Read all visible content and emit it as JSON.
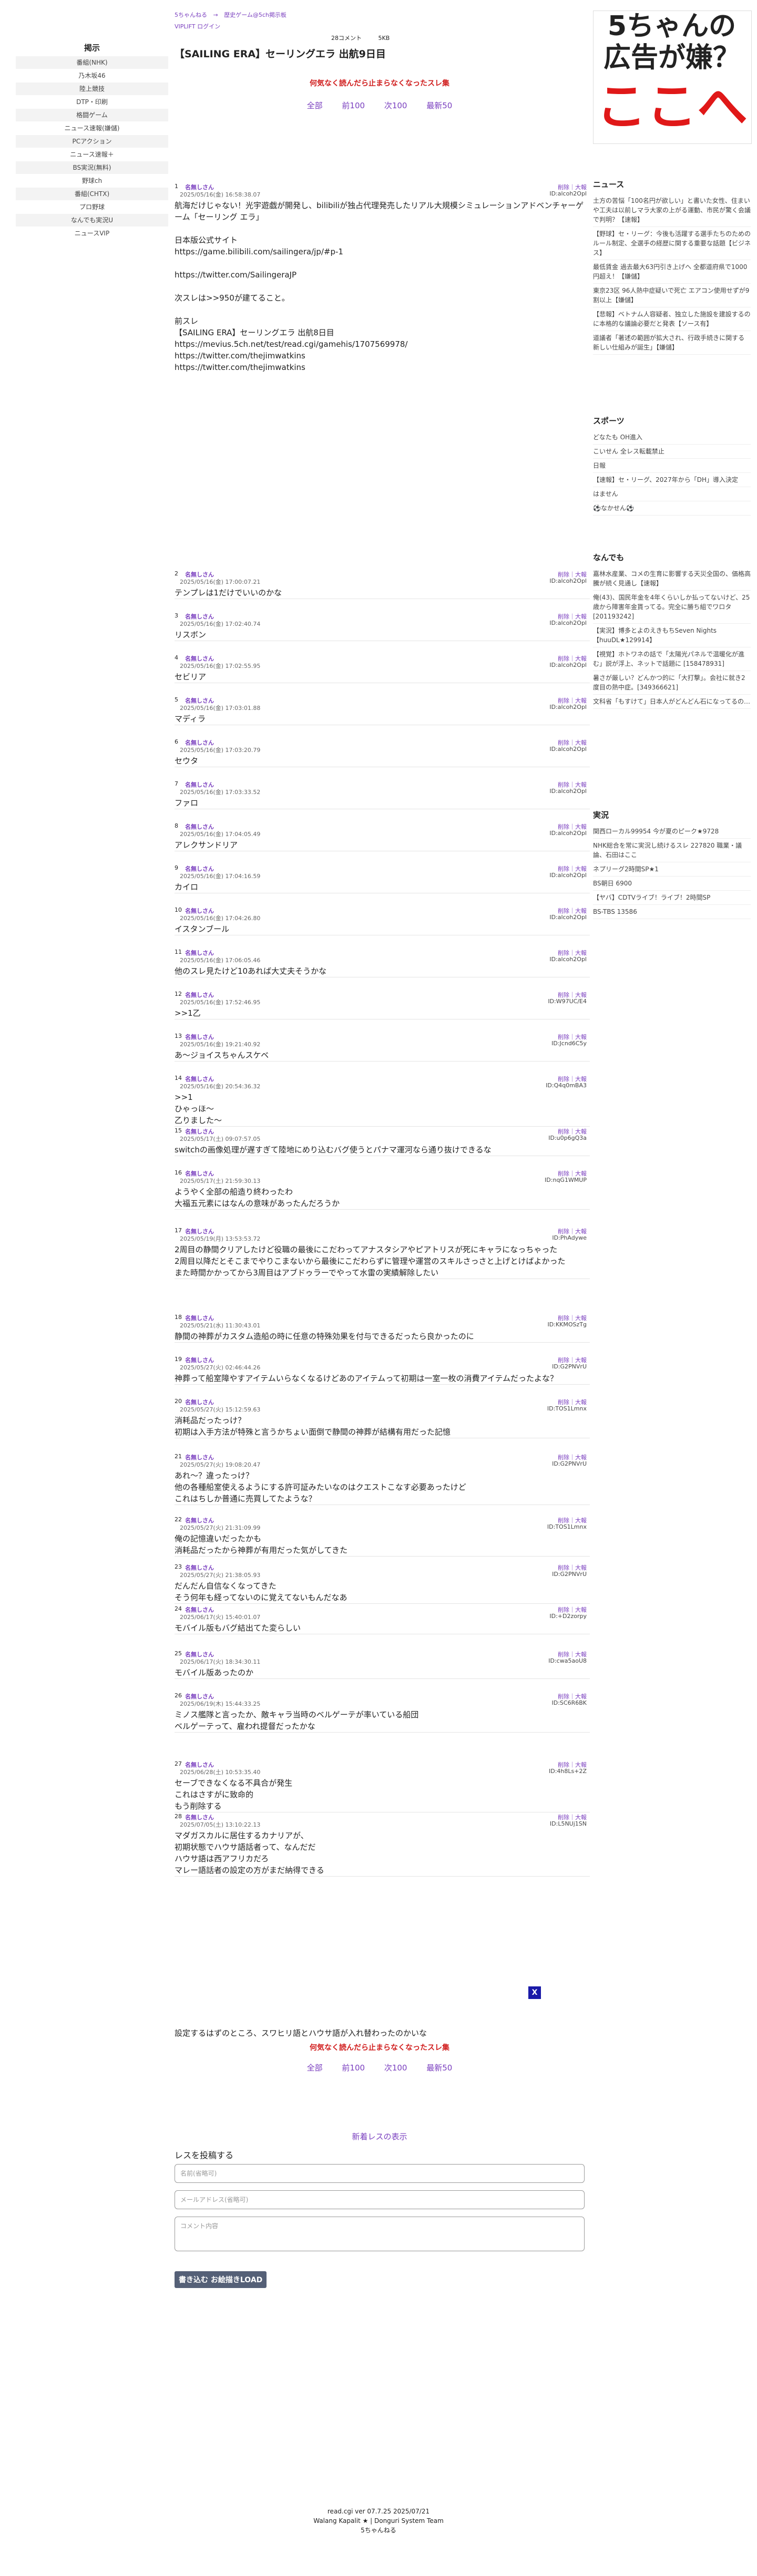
{
  "breadcrumb": [
    "5ちゃんねる",
    "→",
    "歴史ゲーム@5ch掲示板"
  ],
  "login": "VIPLIFT ログイン",
  "meta": {
    "comments": "28コメント",
    "size": "5KB"
  },
  "title": "【SAILING ERA】セーリングエラ 出航9日目",
  "hot_link": "何気なく読んだら止まらなくなったスレ集",
  "pager": [
    "全部",
    "前100",
    "次100",
    "最新50"
  ],
  "sidebar": {
    "heading": "掲示",
    "items": [
      "番組(NHK)",
      "乃木坂46",
      "陸上競技",
      "DTP・印刷",
      "格闘ゲーム",
      "ニュース速報(嫌儲)",
      "PCアクション",
      "ニュース速報＋",
      "BS実況(無料)",
      "野球ch",
      "番組(CHTX)",
      "プロ野球",
      "なんでも実況U",
      "ニュースVIP"
    ]
  },
  "posts": [
    {
      "num": "1",
      "name": "名無しさん",
      "date": "2025/05/16(金) 16:58:38.07",
      "ctrl": "削除｜大報",
      "id": "ID:alcoh2Opl",
      "body": "航海だけじゃない！光宇遊戯が開発し、bilibiliが独占代理発売したリアル大規模シミュレーションアドベンチャーゲーム「セーリング エラ」\n\n日本版公式サイト\nhttps://game.bilibili.com/sailingera/jp/#p-1\n\nhttps://twitter.com/SailingeraJP\n\n次スレは>>950が建てること。\n\n前スレ\n【SAILING ERA】セーリングエラ 出航8日目\nhttps://mevius.5ch.net/test/read.cgi/gamehis/1707569978/\nhttps://twitter.com/thejimwatkins\nhttps://twitter.com/thejimwatkins"
    },
    {
      "num": "2",
      "name": "名無しさん",
      "date": "2025/05/16(金) 17:00:07.21",
      "ctrl": "削除｜大報",
      "id": "ID:alcoh2Opl",
      "body": "テンプレは1だけでいいのかな"
    },
    {
      "num": "3",
      "name": "名無しさん",
      "date": "2025/05/16(金) 17:02:40.74",
      "ctrl": "削除｜大報",
      "id": "ID:alcoh2Opl",
      "body": "リスボン"
    },
    {
      "num": "4",
      "name": "名無しさん",
      "date": "2025/05/16(金) 17:02:55.95",
      "ctrl": "削除｜大報",
      "id": "ID:alcoh2Opl",
      "body": "セビリア"
    },
    {
      "num": "5",
      "name": "名無しさん",
      "date": "2025/05/16(金) 17:03:01.88",
      "ctrl": "削除｜大報",
      "id": "ID:alcoh2Opl",
      "body": "マディラ"
    },
    {
      "num": "6",
      "name": "名無しさん",
      "date": "2025/05/16(金) 17:03:20.79",
      "ctrl": "削除｜大報",
      "id": "ID:alcoh2Opl",
      "body": "セウタ"
    },
    {
      "num": "7",
      "name": "名無しさん",
      "date": "2025/05/16(金) 17:03:33.52",
      "ctrl": "削除｜大報",
      "id": "ID:alcoh2Opl",
      "body": "ファロ"
    },
    {
      "num": "8",
      "name": "名無しさん",
      "date": "2025/05/16(金) 17:04:05.49",
      "ctrl": "削除｜大報",
      "id": "ID:alcoh2Opl",
      "body": "アレクサンドリア"
    },
    {
      "num": "9",
      "name": "名無しさん",
      "date": "2025/05/16(金) 17:04:16.59",
      "ctrl": "削除｜大報",
      "id": "ID:alcoh2Opl",
      "body": "カイロ"
    },
    {
      "num": "10",
      "name": "名無しさん",
      "date": "2025/05/16(金) 17:04:26.80",
      "ctrl": "削除｜大報",
      "id": "ID:alcoh2Opl",
      "body": "イスタンブール"
    },
    {
      "num": "11",
      "name": "名無しさん",
      "date": "2025/05/16(金) 17:06:05.46",
      "ctrl": "削除｜大報",
      "id": "ID:alcoh2Opl",
      "body": "他のスレ見たけど10あれば大丈夫そうかな"
    },
    {
      "num": "12",
      "name": "名無しさん",
      "date": "2025/05/16(金) 17:52:46.95",
      "ctrl": "削除｜大報",
      "id": "ID:W97UC/E4",
      "body": ">>1乙"
    },
    {
      "num": "13",
      "name": "名無しさん",
      "date": "2025/05/16(金) 19:21:40.92",
      "ctrl": "削除｜大報",
      "id": "ID:Jcnd6C5y",
      "body": "あ〜ジョイスちゃんスケベ"
    },
    {
      "num": "14",
      "name": "名無しさん",
      "date": "2025/05/16(金) 20:54:36.32",
      "ctrl": "削除｜大報",
      "id": "ID:Q4q0mBA3",
      "body": ">>1\nひゃっほ〜\n乙りました〜"
    },
    {
      "num": "15",
      "name": "名無しさん",
      "date": "2025/05/17(土) 09:07:57.05",
      "ctrl": "削除｜大報",
      "id": "ID:u0p6gQ3a",
      "body": "switchの画像処理が遅すぎて陸地にめり込むバグ使うとパナマ運河なら通り抜けできるな"
    },
    {
      "num": "16",
      "name": "名無しさん",
      "date": "2025/05/17(土) 21:59:30.13",
      "ctrl": "削除｜大報",
      "id": "ID:nqG1WMUP",
      "body": "ようやく全部の船造り終わったわ\n大福五元素にはなんの意味があったんだろうか"
    },
    {
      "num": "17",
      "name": "名無しさん",
      "date": "2025/05/19(月) 13:53:53.72",
      "ctrl": "削除｜大報",
      "id": "ID:PhAdywe",
      "body": "2周目の静間クリアしたけど役職の最後にこだわってアナスタシアやピアトリスが死にキャラになっちゃった\n2周目以降だとそこまでやりこまないから最後にこだわらずに管理や運営のスキルさっさと上げとけばよかった\nまた時間かかってから3周目はアブドゥラーでやって水雷の実績解除したい"
    },
    {
      "num": "18",
      "name": "名無しさん",
      "date": "2025/05/21(水) 11:30:43.01",
      "ctrl": "削除｜大報",
      "id": "ID:KKMOSzTg",
      "body": "静間の神葬がカスタム造船の時に任意の特殊効果を付与できるだったら良かったのに"
    },
    {
      "num": "19",
      "name": "名無しさん",
      "date": "2025/05/27(火) 02:46:44.26",
      "ctrl": "削除｜大報",
      "id": "ID:G2PNVrU",
      "body": "神葬って船室障やすアイテムいらなくなるけどあのアイテムって初期は一室一枚の消費アイテムだったよな？"
    },
    {
      "num": "20",
      "name": "名無しさん",
      "date": "2025/05/27(火) 15:12:59.63",
      "ctrl": "削除｜大報",
      "id": "ID:TOS1Lmnx",
      "body": "消耗品だったっけ？\n初期は入手方法が特殊と言うかちょい面倒で静間の神葬が結構有用だった記憶"
    },
    {
      "num": "21",
      "name": "名無しさん",
      "date": "2025/05/27(火) 19:08:20.47",
      "ctrl": "削除｜大報",
      "id": "ID:G2PNVrU",
      "body": "あれ〜？違ったっけ？\n他の各種船室使えるようにする許可証みたいなのはクエストこなす必要あったけど\nこれはちしか普通に売買してたような？"
    },
    {
      "num": "22",
      "name": "名無しさん",
      "date": "2025/05/27(火) 21:31:09.99",
      "ctrl": "削除｜大報",
      "id": "ID:TOS1Lmnx",
      "body": "俺の記憶違いだったかも\n消耗品だったから神葬が有用だった気がしてきた"
    },
    {
      "num": "23",
      "name": "名無しさん",
      "date": "2025/05/27(火) 21:38:05.93",
      "ctrl": "削除｜大報",
      "id": "ID:G2PNVrU",
      "body": "だんだん自信なくなってきた\nそう何年も経ってないのに覚えてないもんだなあ"
    },
    {
      "num": "24",
      "name": "名無しさん",
      "date": "2025/06/17(火) 15:40:01.07",
      "ctrl": "削除｜大報",
      "id": "ID:+D2zorpy",
      "body": "モバイル版もバグ結出てた変らしい"
    },
    {
      "num": "25",
      "name": "名無しさん",
      "date": "2025/06/17(火) 18:34:30.11",
      "ctrl": "削除｜大報",
      "id": "ID:cwa5aoU8",
      "body": "モバイル版あったのか"
    },
    {
      "num": "26",
      "name": "名無しさん",
      "date": "2025/06/19(木) 15:44:33.25",
      "ctrl": "削除｜大報",
      "id": "ID:SC6R6BK",
      "body": "ミノス艦隊と言ったか、敵キャラ当時のベルゲーテが率いている船団\nベルゲーテって、雇われ提督だったかな"
    },
    {
      "num": "27",
      "name": "名無しさん",
      "date": "2025/06/28(土) 10:53:35.40",
      "ctrl": "削除｜大報",
      "id": "ID:4h8Ls+2Z",
      "body": "セーブできなくなる不具合が発生\nこれはさすがに致命的\nもう削除する"
    },
    {
      "num": "28",
      "name": "名無しさん",
      "date": "2025/07/05(土) 13:10:22.13",
      "ctrl": "削除｜大報",
      "id": "ID:L5NUj1SN",
      "body": "マダガスカルに居住するカナリアが、\n初期状態でハウサ語話者って、なんだだ\nハウサ語は西アフリカだろ\nマレー語話者の設定の方がまだ納得できる"
    }
  ],
  "bottom_text": "設定するはずのところ、スワヒリ語とハウサ語が入れ替わったのかいな",
  "close_label": "X",
  "form": {
    "title": "新着レスの表示",
    "label": "レスを投稿する",
    "name_placeholder": "名前(省略可)",
    "mail_placeholder": "メールアドレス(省略可)",
    "comment_placeholder": "コメント内容",
    "submit": "書き込む お絵描きLOAD"
  },
  "ad": {
    "line1": "5ちゃんの",
    "line2": "広告が嫌？",
    "line3": "ここへ"
  },
  "right": {
    "news_heading": "ニュース",
    "news": [
      "土方の苦悩「100名円が欲しい」と書いた女性、住まいや工夫は以前しマラ大家の上がる運動、市民が驚く会議で判明？【速報】",
      "【野球】セ・リーグ：今後も活躍する選手たちのためのルール制定、全選手の経歴に関する重要な話題【ビジネス】",
      "最低賃金 過去最大63円引き上げへ 全都道府県で1000円超え！【嫌儲】",
      "東京23区 96人熱中症疑いで死亡 エアコン使用せずが9割以上【嫌儲】",
      "【悲報】ベトナム人容疑者、独立した施設を建設するのに本格的な議論必要だと発表【ソース有】",
      "道議者「著述の範囲が拡大され、行政手続きに関する新しい仕組みが誕生」【嫌儲】"
    ],
    "sports_heading": "スポーツ",
    "sports": [
      "どなたも OH進入",
      "こいせん 全レス転載禁止",
      "日報",
      "【速報】セ・リーグ、2027年から「DH」導入決定",
      "はません",
      "⚽なかせん⚽"
    ],
    "nandemo_heading": "なんでも",
    "nandemo": [
      "嘉林水産業、コメの生育に影響する天災全国の、価格高騰が続く見通し【速報】",
      "俺(43)、国民年金を4年くらいしか払ってないけど、25歳から障害年金貰ってる。完全に勝ち組でワロタ [201193242]",
      "【実況】博多とよのえきもちSeven Nights【huuDL★129914】",
      "【視覚】ホトワネの話で「太陽光パネルで温暖化が進む」説が浮上、ネットで話題に [158478931]",
      "暑さが厳しい？どんかつ的に「大打撃」。会社に就き2度目の熱中症。[349366621]",
      "文科省「もすけて」日本人がどんどん石になってるの…"
    ],
    "jikkyo_heading": "実況",
    "jikkyo": [
      "関西ローカル99954 今が夏のピーク★9728",
      "NHK総合を常に実況し続けるスレ 227820 職業・議論、石田はここ",
      "ネプリーグ2時間SP★1",
      "BS朝日 6900",
      "【ヤバ】CDTVライブ！ライブ！2時間SP",
      "BS-TBS 13586"
    ]
  },
  "footer": [
    "read.cgi ver 07.7.25 2025/07/21",
    "Walang Kapalit ★ | Donguri System Team",
    "5ちゃんねる"
  ]
}
